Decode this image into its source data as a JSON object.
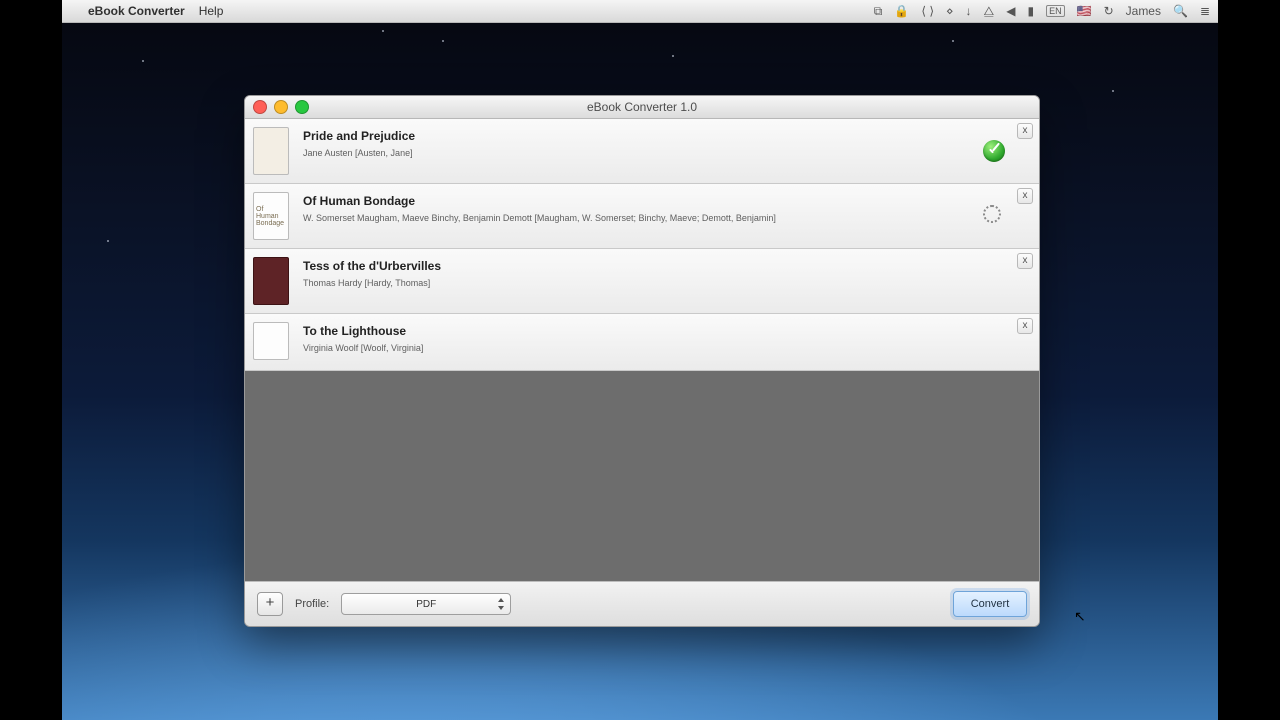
{
  "menubar": {
    "app_name": "eBook Converter",
    "menu_help": "Help",
    "user_name": "James"
  },
  "window": {
    "title": "eBook Converter 1.0"
  },
  "books": [
    {
      "title": "Pride and Prejudice",
      "author": "Jane Austen [Austen, Jane]",
      "status": "done",
      "thumb": "beige"
    },
    {
      "title": "Of Human Bondage",
      "author": "W. Somerset Maugham, Maeve Binchy, Benjamin Demott [Maugham, W. Somerset; Binchy, Maeve; Demott, Benjamin]",
      "status": "working",
      "thumb": "white"
    },
    {
      "title": "Tess of the d'Urbervilles",
      "author": "Thomas Hardy [Hardy, Thomas]",
      "status": "none",
      "thumb": "maroon"
    },
    {
      "title": "To the Lighthouse",
      "author": "Virginia Woolf [Woolf, Virginia]",
      "status": "none",
      "thumb": "white"
    }
  ],
  "bottombar": {
    "profile_label": "Profile:",
    "profile_value": "PDF",
    "convert_label": "Convert"
  }
}
